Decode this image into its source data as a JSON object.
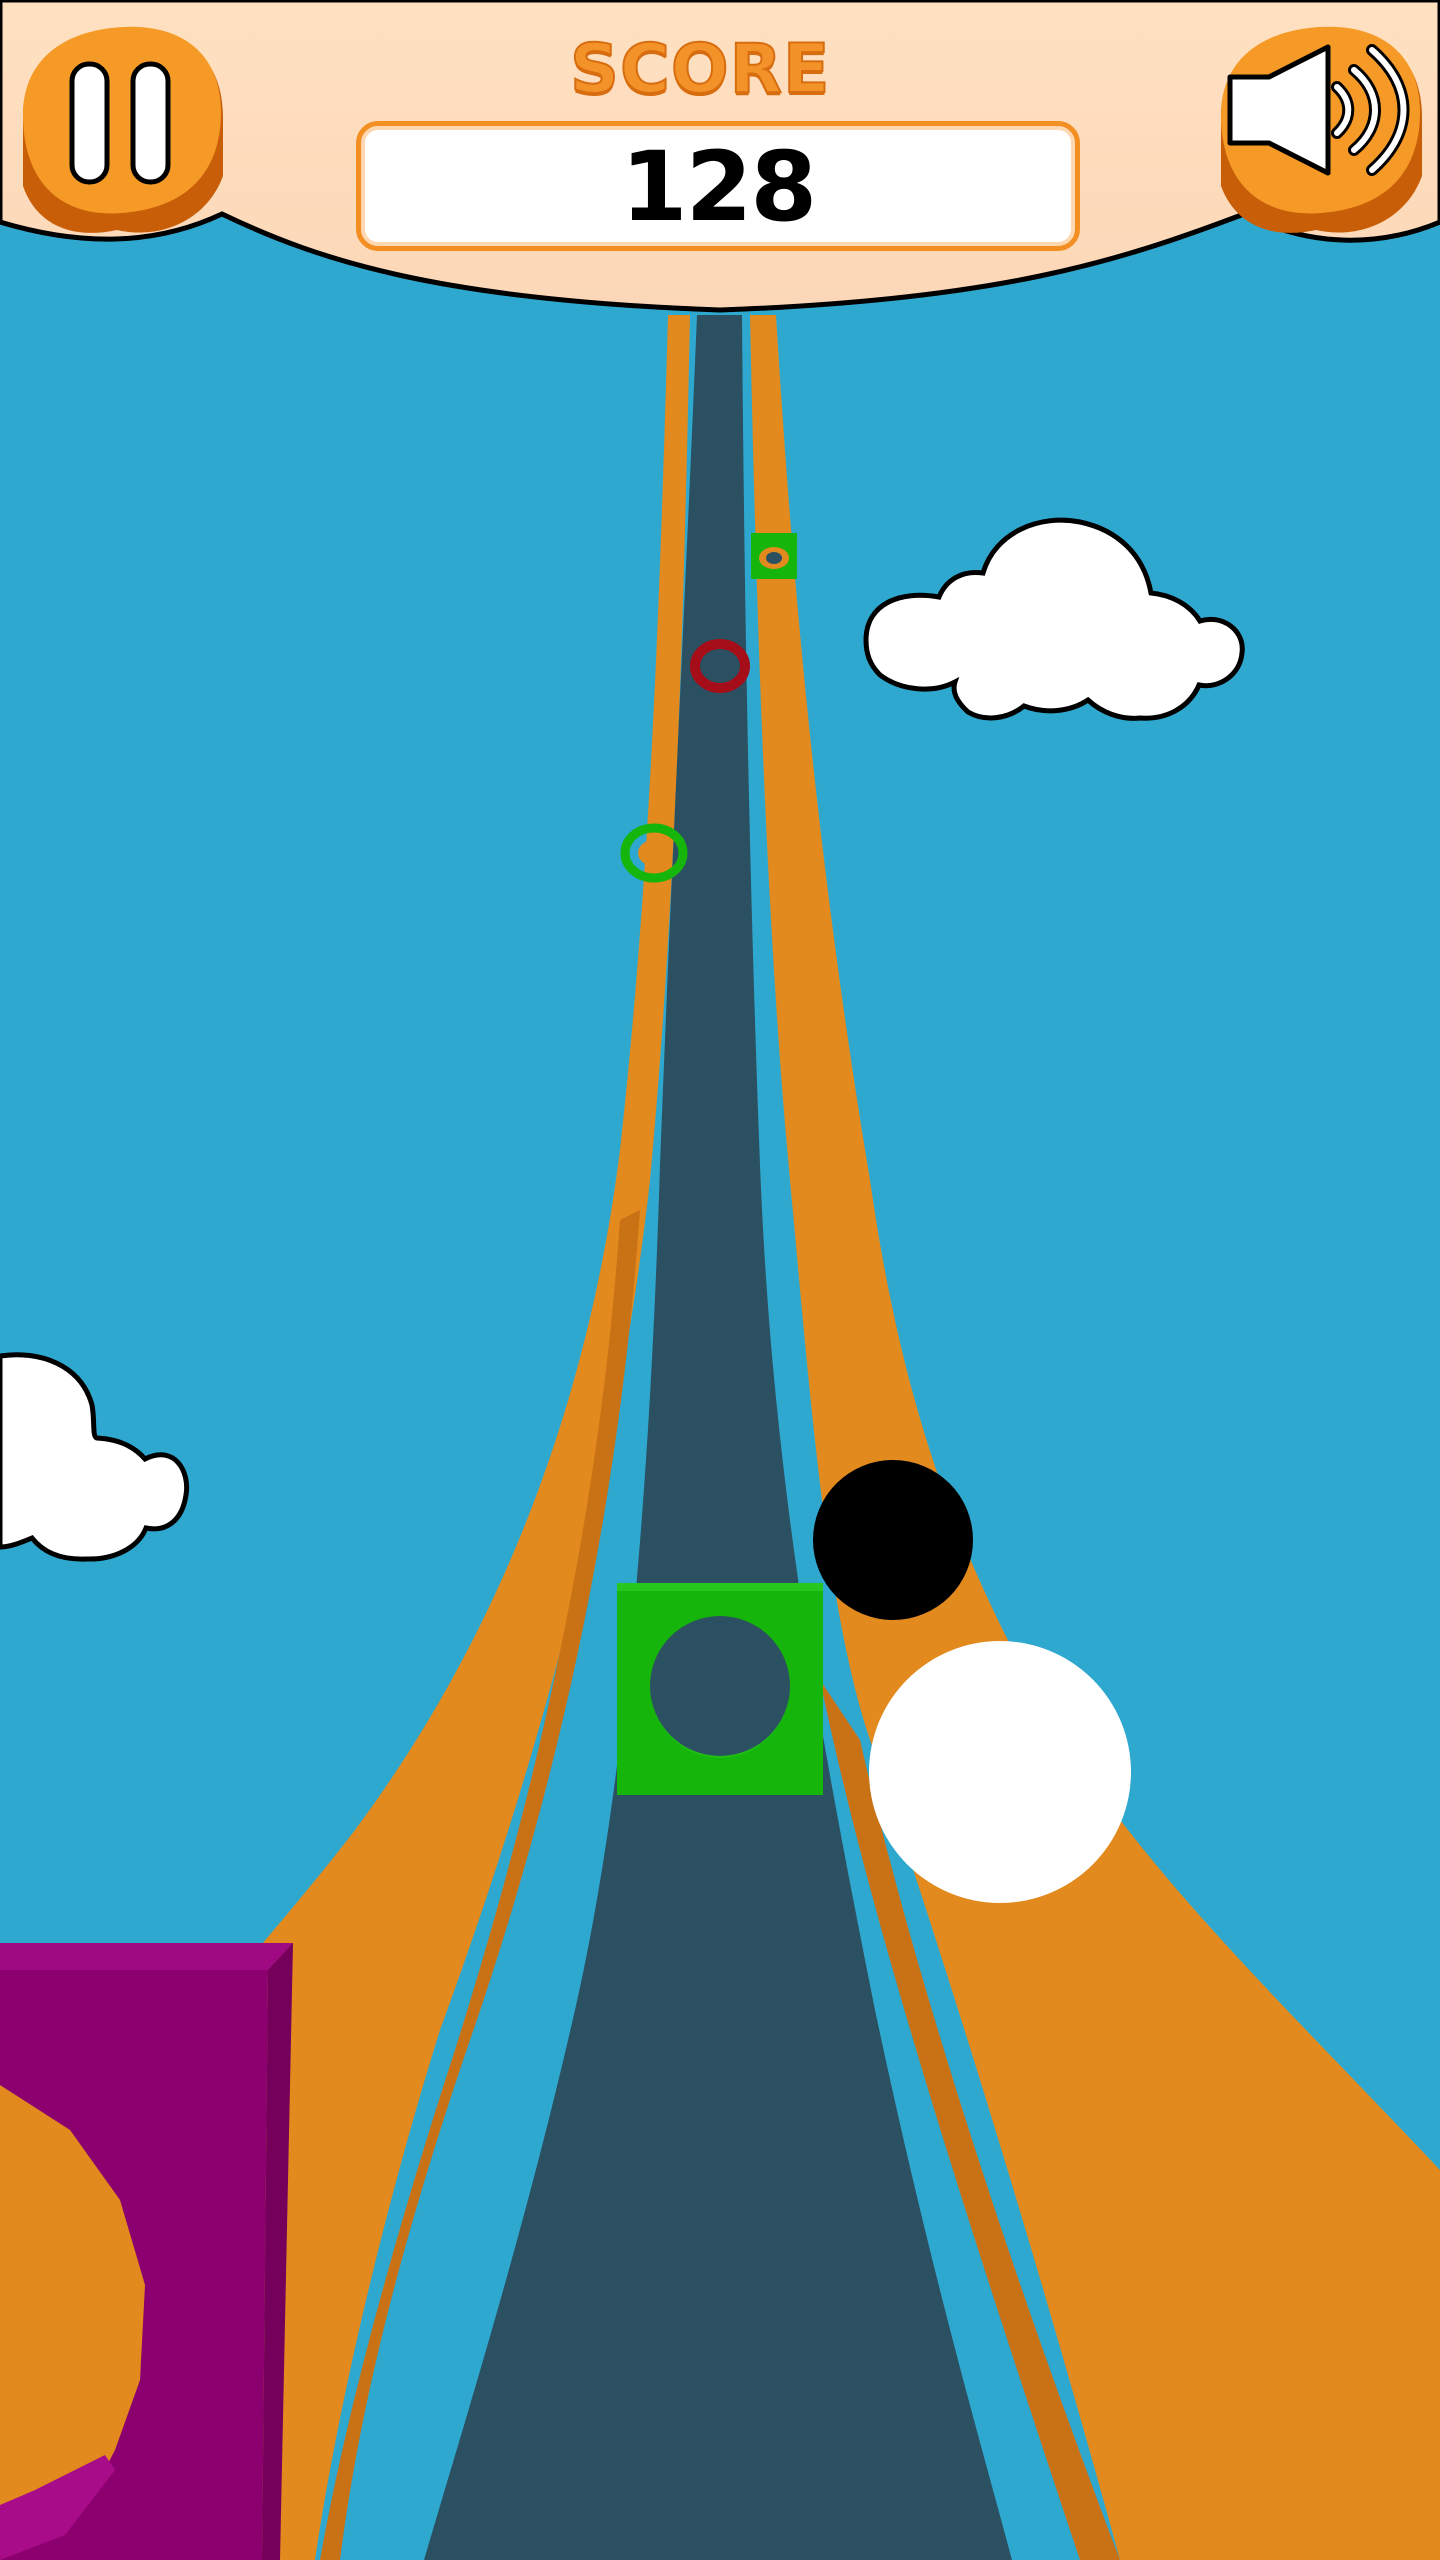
{
  "game": {
    "hud": {
      "score_label": "SCORE",
      "score_value": "128",
      "pause_icon": "pause-icon",
      "sound_icon": "speaker-volume-icon"
    },
    "scene": {
      "background_color": "#2fa8cf",
      "track_color": "#e28a1e",
      "lane_color": "#2b5062",
      "obstacle_color": "#15b50b",
      "hazard_color": "#a50d18",
      "block_color": "#8b006e",
      "ball_colors": [
        "#000000",
        "#ffffff"
      ]
    }
  }
}
